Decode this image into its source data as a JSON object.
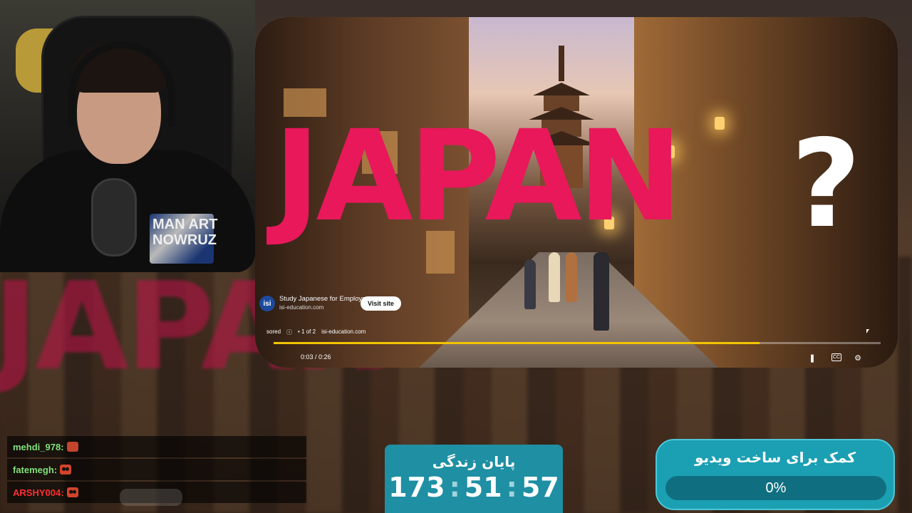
{
  "video": {
    "title_overlay": "JAPAN",
    "title_question": "?",
    "ad": {
      "logo_text": "isi",
      "headline": "Study Japanese for Employment",
      "domain": "isi-education.com",
      "visit_label": "Visit site",
      "sponsored_label": "sored",
      "ad_count": "• 1 of 2",
      "sponsored_domain": "isi-education.com"
    },
    "time_display": "0:03 / 0:26",
    "progress": 0.8
  },
  "webcam": {
    "shirt_print": "MAN ART NOWRUZ"
  },
  "chat": {
    "messages": [
      {
        "user": "mehdi_978:",
        "color": "#7fe07a"
      },
      {
        "user": "fatemegh:",
        "color": "#7fe07a"
      },
      {
        "user": "ARSHY004:",
        "color": "#ff3030"
      }
    ]
  },
  "countdown": {
    "label": "پایان زندگی",
    "hours": "173",
    "minutes": "51",
    "seconds": "57"
  },
  "goal": {
    "label": "کمک برای ساخت ویدیو",
    "percent_text": "0%",
    "progress": 0.0
  },
  "icons": {
    "pause": "pause-icon",
    "cc": "cc-icon",
    "settings": "gear-icon",
    "info": "info-icon"
  }
}
